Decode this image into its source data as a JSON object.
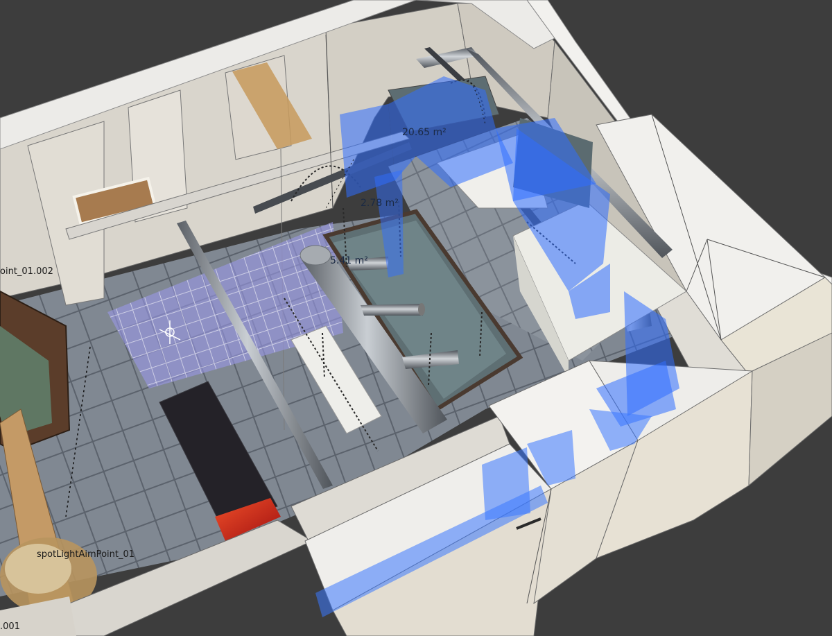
{
  "viewport": {
    "area_labels": {
      "large": "20.65 m²",
      "medium": "2.78 m²",
      "small": "5.41 m²"
    },
    "object_labels": {
      "left_point": "oint_01.002",
      "spot_aim": "spotLightAimPoint_01",
      "bottom_left": ".001"
    }
  },
  "colors": {
    "background": "#3d3d3d",
    "wall": "#e3e0d8",
    "wall_top": "#ece9e4",
    "floor_tile": "#7e8690",
    "selection_blue": "#2f6dff",
    "text": "#1a1a1a"
  }
}
